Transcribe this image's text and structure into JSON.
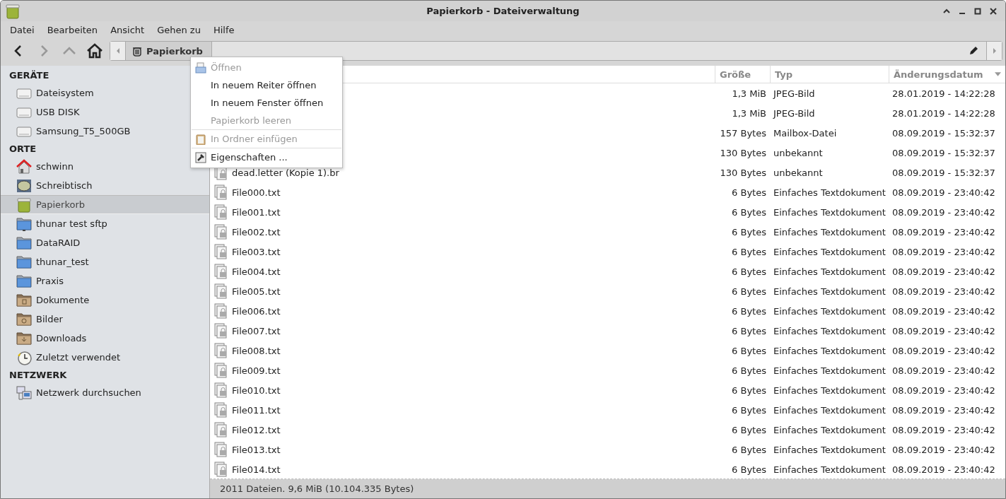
{
  "window": {
    "title": "Papierkorb - Dateiverwaltung"
  },
  "menubar": [
    "Datei",
    "Bearbeiten",
    "Ansicht",
    "Gehen zu",
    "Hilfe"
  ],
  "toolbar": {
    "back_disabled": false,
    "forward_disabled": true,
    "up_disabled": true
  },
  "pathbar": {
    "crumb": "Papierkorb"
  },
  "sidebar": [
    {
      "heading": "GERÄTE",
      "items": [
        {
          "label": "Dateisystem",
          "kind": "drive",
          "selected": false
        },
        {
          "label": "USB DISK",
          "kind": "drive",
          "selected": false
        },
        {
          "label": "Samsung_T5_500GB",
          "kind": "drive",
          "selected": false
        }
      ]
    },
    {
      "heading": "ORTE",
      "items": [
        {
          "label": "schwinn",
          "kind": "home",
          "selected": false
        },
        {
          "label": "Schreibtisch",
          "kind": "desktop",
          "selected": false
        },
        {
          "label": "Papierkorb",
          "kind": "trash",
          "selected": true
        },
        {
          "label": "thunar test sftp",
          "kind": "remote",
          "selected": false
        },
        {
          "label": "DataRAID",
          "kind": "folder",
          "selected": false
        },
        {
          "label": "thunar_test",
          "kind": "folder",
          "selected": false
        },
        {
          "label": "Praxis",
          "kind": "folder",
          "selected": false
        },
        {
          "label": "Dokumente",
          "kind": "documents",
          "selected": false
        },
        {
          "label": "Bilder",
          "kind": "pictures",
          "selected": false
        },
        {
          "label": "Downloads",
          "kind": "downloads",
          "selected": false
        },
        {
          "label": "Zuletzt verwendet",
          "kind": "recent",
          "selected": false
        }
      ]
    },
    {
      "heading": "NETZWERK",
      "items": [
        {
          "label": "Netzwerk durchsuchen",
          "kind": "network",
          "selected": false
        }
      ]
    }
  ],
  "table": {
    "columns": [
      {
        "label": "Größe",
        "sorted": false
      },
      {
        "label": "Typ",
        "sorted": false
      },
      {
        "label": "Änderungsdatum",
        "sorted": true
      }
    ],
    "rows": [
      {
        "size": "1,3 MiB",
        "type": "JPEG-Bild",
        "date": "28.01.2019 - 14:22:28"
      },
      {
        "size": "1,3 MiB",
        "type": "JPEG-Bild",
        "date": "28.01.2019 - 14:22:28"
      },
      {
        "size": "157 Bytes",
        "type": "Mailbox-Datei",
        "date": "08.09.2019 - 15:32:37"
      },
      {
        "size": "130 Bytes",
        "type": "unbekannt",
        "date": "08.09.2019 - 15:32:37"
      },
      {
        "name": "dead.letter (Kopie 1).br",
        "size": "130 Bytes",
        "type": "unbekannt",
        "date": "08.09.2019 - 15:32:37"
      },
      {
        "name": "File000.txt",
        "size": "6 Bytes",
        "type": "Einfaches Textdokument",
        "date": "08.09.2019 - 23:40:42"
      },
      {
        "name": "File001.txt",
        "size": "6 Bytes",
        "type": "Einfaches Textdokument",
        "date": "08.09.2019 - 23:40:42"
      },
      {
        "name": "File002.txt",
        "size": "6 Bytes",
        "type": "Einfaches Textdokument",
        "date": "08.09.2019 - 23:40:42"
      },
      {
        "name": "File003.txt",
        "size": "6 Bytes",
        "type": "Einfaches Textdokument",
        "date": "08.09.2019 - 23:40:42"
      },
      {
        "name": "File004.txt",
        "size": "6 Bytes",
        "type": "Einfaches Textdokument",
        "date": "08.09.2019 - 23:40:42"
      },
      {
        "name": "File005.txt",
        "size": "6 Bytes",
        "type": "Einfaches Textdokument",
        "date": "08.09.2019 - 23:40:42"
      },
      {
        "name": "File006.txt",
        "size": "6 Bytes",
        "type": "Einfaches Textdokument",
        "date": "08.09.2019 - 23:40:42"
      },
      {
        "name": "File007.txt",
        "size": "6 Bytes",
        "type": "Einfaches Textdokument",
        "date": "08.09.2019 - 23:40:42"
      },
      {
        "name": "File008.txt",
        "size": "6 Bytes",
        "type": "Einfaches Textdokument",
        "date": "08.09.2019 - 23:40:42"
      },
      {
        "name": "File009.txt",
        "size": "6 Bytes",
        "type": "Einfaches Textdokument",
        "date": "08.09.2019 - 23:40:42"
      },
      {
        "name": "File010.txt",
        "size": "6 Bytes",
        "type": "Einfaches Textdokument",
        "date": "08.09.2019 - 23:40:42"
      },
      {
        "name": "File011.txt",
        "size": "6 Bytes",
        "type": "Einfaches Textdokument",
        "date": "08.09.2019 - 23:40:42"
      },
      {
        "name": "File012.txt",
        "size": "6 Bytes",
        "type": "Einfaches Textdokument",
        "date": "08.09.2019 - 23:40:42"
      },
      {
        "name": "File013.txt",
        "size": "6 Bytes",
        "type": "Einfaches Textdokument",
        "date": "08.09.2019 - 23:40:42"
      },
      {
        "name": "File014.txt",
        "size": "6 Bytes",
        "type": "Einfaches Textdokument",
        "date": "08.09.2019 - 23:40:42"
      }
    ]
  },
  "context_menu": [
    {
      "label": "Öffnen",
      "disabled": true,
      "kind": "open",
      "separator_before": false
    },
    {
      "label": "In neuem Reiter öffnen",
      "disabled": false,
      "separator_before": false
    },
    {
      "label": "In neuem Fenster öffnen",
      "disabled": false,
      "separator_before": false
    },
    {
      "label": "Papierkorb leeren",
      "disabled": true,
      "separator_before": false
    },
    {
      "label": "In Ordner einfügen",
      "disabled": true,
      "kind": "paste",
      "separator_before": true
    },
    {
      "label": "Eigenschaften ...",
      "disabled": false,
      "kind": "properties",
      "separator_before": true
    }
  ],
  "status_bar": "2011 Dateien. 9,6 MiB (10.104.335 Bytes)"
}
